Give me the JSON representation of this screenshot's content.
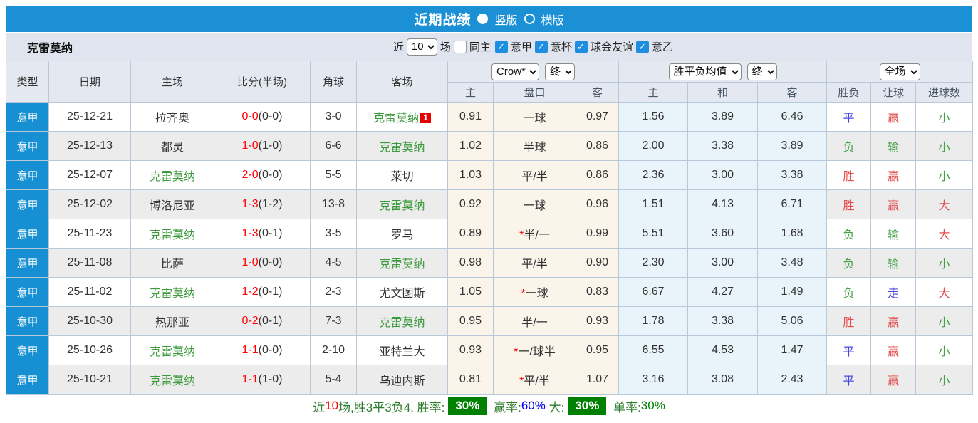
{
  "topbar": {
    "title": "近期战绩",
    "vertical_label": "竖版",
    "horizontal_label": "横版"
  },
  "filter": {
    "team": "克雷莫纳",
    "near_label": "近",
    "count": "10",
    "games_label": "场",
    "same_home_label": "同主",
    "leagues": [
      "意甲",
      "意杯",
      "球会友谊",
      "意乙"
    ]
  },
  "table": {
    "main_headers": [
      "类型",
      "日期",
      "主场",
      "比分(半场)",
      "角球",
      "客场"
    ],
    "controls": {
      "ah_company": "Crow*",
      "ah_time": "终",
      "odds_type": "胜平负均值",
      "odds_time": "终",
      "scope": "全场"
    },
    "sub_headers": [
      "主",
      "盘口",
      "客",
      "主",
      "和",
      "客",
      "胜负",
      "让球",
      "进球数"
    ],
    "rows": [
      {
        "league": "意甲",
        "date": "25-12-21",
        "home": "拉齐奥",
        "home_is_team": false,
        "score": "0-0",
        "half": "(0-0)",
        "corner": "3-0",
        "away": "克雷莫纳",
        "away_is_team": true,
        "away_badge": "1",
        "ah_home": "0.91",
        "handicap": "一球",
        "handicap_star": false,
        "ah_away": "0.97",
        "odds_home": "1.56",
        "odds_draw": "3.89",
        "odds_away": "6.46",
        "result": "平",
        "result_color": "blue",
        "ah_result": "赢",
        "ah_result_color": "red",
        "goals": "小",
        "goals_color": "green"
      },
      {
        "league": "意甲",
        "date": "25-12-13",
        "home": "都灵",
        "home_is_team": false,
        "score": "1-0",
        "half": "(1-0)",
        "corner": "6-6",
        "away": "克雷莫纳",
        "away_is_team": true,
        "away_badge": "",
        "ah_home": "1.02",
        "handicap": "半球",
        "handicap_star": false,
        "ah_away": "0.86",
        "odds_home": "2.00",
        "odds_draw": "3.38",
        "odds_away": "3.89",
        "result": "负",
        "result_color": "green",
        "ah_result": "输",
        "ah_result_color": "green",
        "goals": "小",
        "goals_color": "green"
      },
      {
        "league": "意甲",
        "date": "25-12-07",
        "home": "克雷莫纳",
        "home_is_team": true,
        "score": "2-0",
        "half": "(0-0)",
        "corner": "5-5",
        "away": "莱切",
        "away_is_team": false,
        "away_badge": "",
        "ah_home": "1.03",
        "handicap": "平/半",
        "handicap_star": false,
        "ah_away": "0.86",
        "odds_home": "2.36",
        "odds_draw": "3.00",
        "odds_away": "3.38",
        "result": "胜",
        "result_color": "red",
        "ah_result": "赢",
        "ah_result_color": "red",
        "goals": "小",
        "goals_color": "green"
      },
      {
        "league": "意甲",
        "date": "25-12-02",
        "home": "博洛尼亚",
        "home_is_team": false,
        "score": "1-3",
        "half": "(1-2)",
        "corner": "13-8",
        "away": "克雷莫纳",
        "away_is_team": true,
        "away_badge": "",
        "ah_home": "0.92",
        "handicap": "一球",
        "handicap_star": false,
        "ah_away": "0.96",
        "odds_home": "1.51",
        "odds_draw": "4.13",
        "odds_away": "6.71",
        "result": "胜",
        "result_color": "red",
        "ah_result": "赢",
        "ah_result_color": "red",
        "goals": "大",
        "goals_color": "red"
      },
      {
        "league": "意甲",
        "date": "25-11-23",
        "home": "克雷莫纳",
        "home_is_team": true,
        "score": "1-3",
        "half": "(0-1)",
        "corner": "3-5",
        "away": "罗马",
        "away_is_team": false,
        "away_badge": "",
        "ah_home": "0.89",
        "handicap": "半/一",
        "handicap_star": true,
        "ah_away": "0.99",
        "odds_home": "5.51",
        "odds_draw": "3.60",
        "odds_away": "1.68",
        "result": "负",
        "result_color": "green",
        "ah_result": "输",
        "ah_result_color": "green",
        "goals": "大",
        "goals_color": "red"
      },
      {
        "league": "意甲",
        "date": "25-11-08",
        "home": "比萨",
        "home_is_team": false,
        "score": "1-0",
        "half": "(0-0)",
        "corner": "4-5",
        "away": "克雷莫纳",
        "away_is_team": true,
        "away_badge": "",
        "ah_home": "0.98",
        "handicap": "平/半",
        "handicap_star": false,
        "ah_away": "0.90",
        "odds_home": "2.30",
        "odds_draw": "3.00",
        "odds_away": "3.48",
        "result": "负",
        "result_color": "green",
        "ah_result": "输",
        "ah_result_color": "green",
        "goals": "小",
        "goals_color": "green"
      },
      {
        "league": "意甲",
        "date": "25-11-02",
        "home": "克雷莫纳",
        "home_is_team": true,
        "score": "1-2",
        "half": "(0-1)",
        "corner": "2-3",
        "away": "尤文图斯",
        "away_is_team": false,
        "away_badge": "",
        "ah_home": "1.05",
        "handicap": "一球",
        "handicap_star": true,
        "ah_away": "0.83",
        "odds_home": "6.67",
        "odds_draw": "4.27",
        "odds_away": "1.49",
        "result": "负",
        "result_color": "green",
        "ah_result": "走",
        "ah_result_color": "blue",
        "goals": "大",
        "goals_color": "red"
      },
      {
        "league": "意甲",
        "date": "25-10-30",
        "home": "热那亚",
        "home_is_team": false,
        "score": "0-2",
        "half": "(0-1)",
        "corner": "7-3",
        "away": "克雷莫纳",
        "away_is_team": true,
        "away_badge": "",
        "ah_home": "0.95",
        "handicap": "半/一",
        "handicap_star": false,
        "ah_away": "0.93",
        "odds_home": "1.78",
        "odds_draw": "3.38",
        "odds_away": "5.06",
        "result": "胜",
        "result_color": "red",
        "ah_result": "赢",
        "ah_result_color": "red",
        "goals": "小",
        "goals_color": "green"
      },
      {
        "league": "意甲",
        "date": "25-10-26",
        "home": "克雷莫纳",
        "home_is_team": true,
        "score": "1-1",
        "half": "(0-0)",
        "corner": "2-10",
        "away": "亚特兰大",
        "away_is_team": false,
        "away_badge": "",
        "ah_home": "0.93",
        "handicap": "一/球半",
        "handicap_star": true,
        "ah_away": "0.95",
        "odds_home": "6.55",
        "odds_draw": "4.53",
        "odds_away": "1.47",
        "result": "平",
        "result_color": "blue",
        "ah_result": "赢",
        "ah_result_color": "red",
        "goals": "小",
        "goals_color": "green"
      },
      {
        "league": "意甲",
        "date": "25-10-21",
        "home": "克雷莫纳",
        "home_is_team": true,
        "score": "1-1",
        "half": "(1-0)",
        "corner": "5-4",
        "away": "乌迪内斯",
        "away_is_team": false,
        "away_badge": "",
        "ah_home": "0.81",
        "handicap": "平/半",
        "handicap_star": true,
        "ah_away": "1.07",
        "odds_home": "3.16",
        "odds_draw": "3.08",
        "odds_away": "2.43",
        "result": "平",
        "result_color": "blue",
        "ah_result": "赢",
        "ah_result_color": "red",
        "goals": "小",
        "goals_color": "green"
      }
    ]
  },
  "footer": {
    "segments": [
      {
        "text": "近",
        "color": "label",
        "name": "footer-near-label"
      },
      {
        "text": "10",
        "color": "red",
        "name": "footer-count-value"
      },
      {
        "text": "场,胜3平3负4, 胜率:",
        "color": "label",
        "name": "footer-record-text"
      },
      {
        "text": "30%",
        "badge": true,
        "name": "win-rate-badge"
      },
      {
        "text": " 赢率:",
        "color": "label",
        "name": "footer-ah-rate-label"
      },
      {
        "text": "60%",
        "color": "blue",
        "name": "ah-win-rate-value"
      },
      {
        "text": " 大:",
        "color": "label",
        "name": "footer-big-label"
      },
      {
        "text": "30%",
        "badge": true,
        "name": "big-rate-badge"
      },
      {
        "text": " 单率:",
        "color": "label",
        "name": "footer-odd-rate-label"
      },
      {
        "text": "30%",
        "color": "green",
        "name": "odd-rate-value"
      }
    ]
  },
  "colors": {
    "bar_blue": "#1b90d5",
    "league_cell_blue": "#1690d2",
    "filter_bar_bg": "#dfe4ee",
    "header_bg": "#e4e9f1",
    "alt_row_bg": "#ececec",
    "handicap_col_bg": "#faf4eb",
    "euro_odds_col_bg": "#e9f3fa",
    "score_red": "#ff0000",
    "team_green": "#3c9a3c",
    "win_red": "#e34d4d",
    "lose_green": "#44a044",
    "draw_blue": "#4747e0",
    "badge_green": "#008000"
  }
}
